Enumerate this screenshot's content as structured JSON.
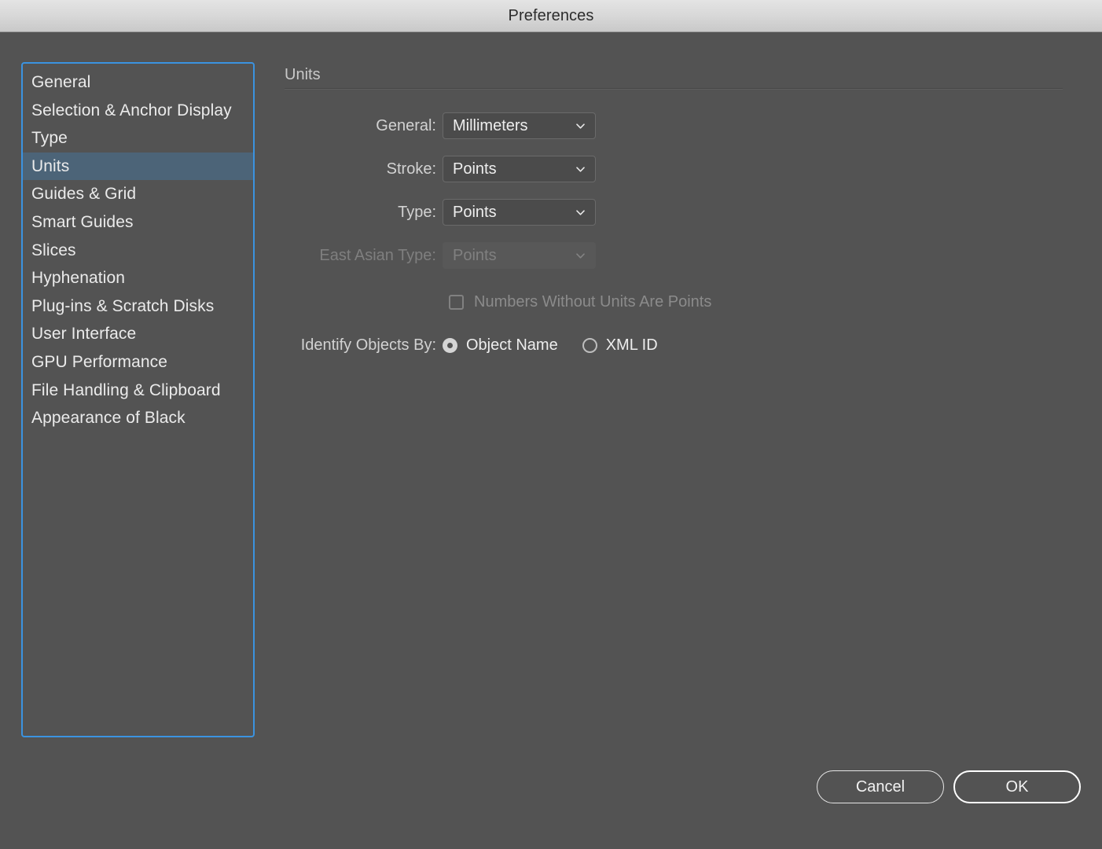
{
  "window": {
    "title": "Preferences"
  },
  "sidebar": {
    "name": "preferences-categories",
    "selected": "Units",
    "items": [
      {
        "label": "General"
      },
      {
        "label": "Selection & Anchor Display"
      },
      {
        "label": "Type"
      },
      {
        "label": "Units"
      },
      {
        "label": "Guides & Grid"
      },
      {
        "label": "Smart Guides"
      },
      {
        "label": "Slices"
      },
      {
        "label": "Hyphenation"
      },
      {
        "label": "Plug-ins & Scratch Disks"
      },
      {
        "label": "User Interface"
      },
      {
        "label": "GPU Performance"
      },
      {
        "label": "File Handling & Clipboard"
      },
      {
        "label": "Appearance of Black"
      }
    ]
  },
  "panel": {
    "section_title": "Units",
    "fields": [
      {
        "label": "General:",
        "value": "Millimeters",
        "disabled": false,
        "icon": "chevron-down-icon"
      },
      {
        "label": "Stroke:",
        "value": "Points",
        "disabled": false,
        "icon": "chevron-down-icon"
      },
      {
        "label": "Type:",
        "value": "Points",
        "disabled": false,
        "icon": "chevron-down-icon"
      },
      {
        "label": "East Asian Type:",
        "value": "Points",
        "disabled": true,
        "icon": "chevron-down-icon"
      }
    ],
    "checkbox": {
      "label": "Numbers Without Units Are Points",
      "checked": false,
      "disabled": true
    },
    "identify_objects": {
      "label": "Identify Objects By:",
      "options": [
        {
          "label": "Object Name",
          "selected": true
        },
        {
          "label": "XML ID",
          "selected": false
        }
      ]
    }
  },
  "buttons": {
    "cancel": "Cancel",
    "ok": "OK"
  },
  "colors": {
    "background": "#535353",
    "selection": "#4c6478",
    "focus_ring": "#3b93e0",
    "titlebar_text": "#2c2c2c",
    "text": "#ebebeb",
    "text_disabled": "#808080"
  }
}
